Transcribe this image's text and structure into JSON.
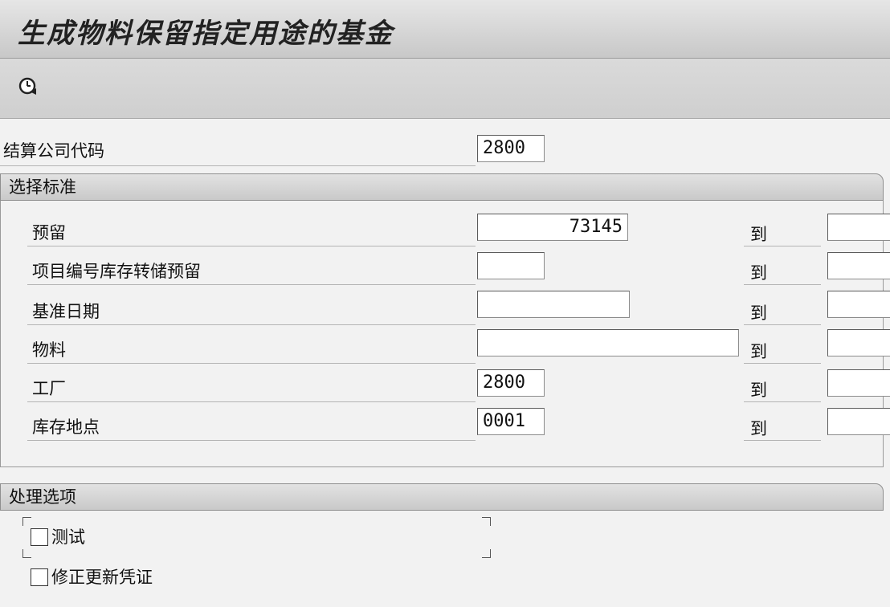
{
  "title": "生成物料保留指定用途的基金",
  "toolbar": {
    "execute_icon": "clock-execute-icon"
  },
  "company_code": {
    "label": "结算公司代码",
    "value": "2800"
  },
  "selection": {
    "header": "选择标准",
    "to_label": "到",
    "rows": [
      {
        "label": "预留",
        "from": "73145",
        "to": ""
      },
      {
        "label": "项目编号库存转储预留",
        "from": "",
        "to": ""
      },
      {
        "label": "基准日期",
        "from": "",
        "to": ""
      },
      {
        "label": "物料",
        "from": "",
        "to": ""
      },
      {
        "label": "工厂",
        "from": "2800",
        "to": ""
      },
      {
        "label": "库存地点",
        "from": "0001",
        "to": ""
      }
    ]
  },
  "processing": {
    "header": "处理选项",
    "test_label": "测试",
    "correct_label": "修正更新凭证"
  }
}
